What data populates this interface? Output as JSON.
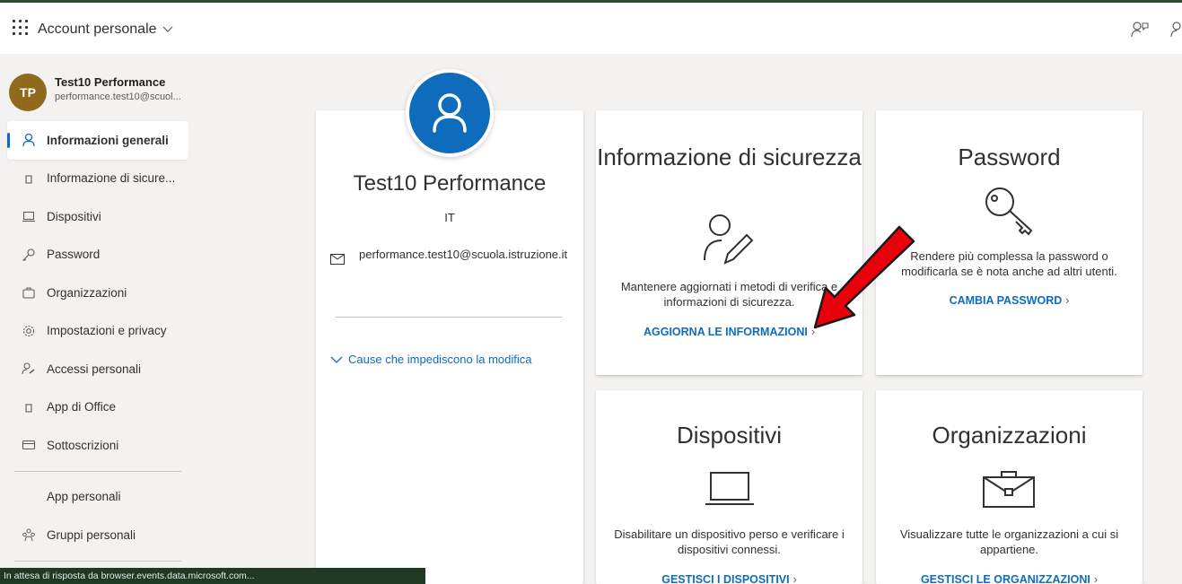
{
  "header": {
    "app_title": "Account personale"
  },
  "user": {
    "initials": "TP",
    "name": "Test10 Performance",
    "email_short": "performance.test10@scuol..."
  },
  "sidebar": {
    "items": [
      {
        "label": "Informazioni generali",
        "icon": "person-icon"
      },
      {
        "label": "Informazione di sicure...",
        "icon": "security-icon"
      },
      {
        "label": "Dispositivi",
        "icon": "laptop-icon"
      },
      {
        "label": "Password",
        "icon": "key-icon"
      },
      {
        "label": "Organizzazioni",
        "icon": "briefcase-icon"
      },
      {
        "label": "Impostazioni e privacy",
        "icon": "gear-icon"
      },
      {
        "label": "Accessi personali",
        "icon": "sign-in-icon"
      },
      {
        "label": "App di Office",
        "icon": "office-icon"
      },
      {
        "label": "Sottoscrizioni",
        "icon": "card-icon"
      }
    ],
    "extra": [
      {
        "label": "App personali"
      },
      {
        "label": "Gruppi personali",
        "icon": "groups-icon"
      }
    ]
  },
  "profile_card": {
    "name": "Test10 Performance",
    "country": "IT",
    "email": "performance.test10@scuola.istruzione.it",
    "cause_link": "Cause che impediscono la modifica"
  },
  "cards": {
    "security": {
      "title": "Informazione di sicurezza",
      "desc": "Mantenere aggiornati i metodi di verifica e informazioni di sicurezza.",
      "link": "AGGIORNA LE INFORMAZIONI"
    },
    "password": {
      "title": "Password",
      "desc": "Rendere più complessa la password o modificarla se è nota anche ad altri utenti.",
      "link": "CAMBIA PASSWORD"
    },
    "devices": {
      "title": "Dispositivi",
      "desc": "Disabilitare un dispositivo perso e verificare i dispositivi connessi.",
      "link": "GESTISCI I DISPOSITIVI"
    },
    "organizations": {
      "title": "Organizzazioni",
      "desc": "Visualizzare tutte le organizzazioni a cui si appartiene.",
      "link": "GESTISCI LE ORGANIZZAZIONI"
    }
  },
  "status_bar": {
    "text": "In attesa di risposta da browser.events.data.microsoft.com..."
  },
  "colors": {
    "accent": "#0f6cbd",
    "avatar": "#8f6a1c",
    "arrow": "#e8000b"
  }
}
